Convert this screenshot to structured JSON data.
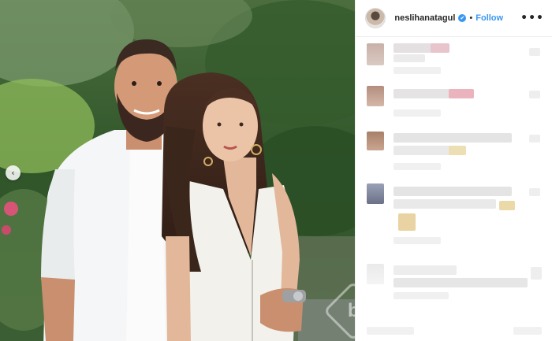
{
  "header": {
    "username": "neslihanatagul",
    "verified_icon": "✔",
    "separator": "•",
    "follow_label": "Follow",
    "more_label": "•••"
  },
  "photo": {
    "prev_label": "‹",
    "watermark_letter": "b"
  },
  "colors": {
    "link_blue": "#3897f0",
    "text_dark": "#262626",
    "border": "#efefef"
  }
}
